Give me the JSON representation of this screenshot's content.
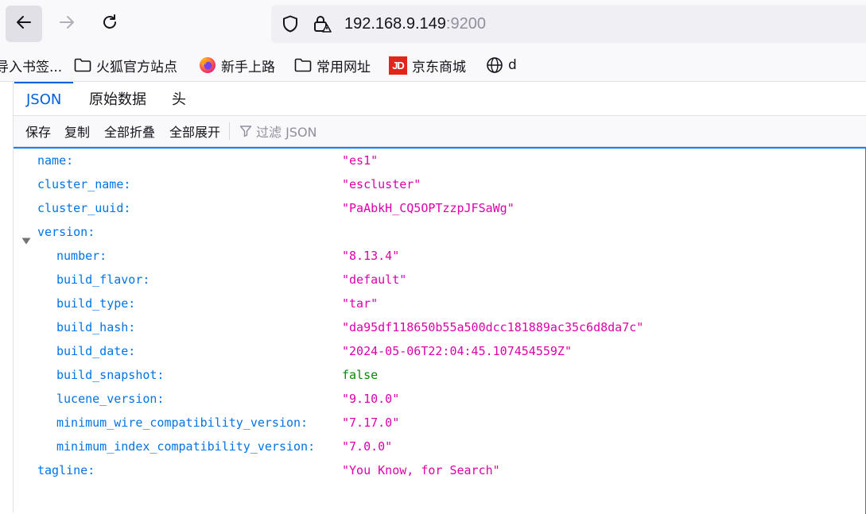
{
  "browser": {
    "url_host": "192.168.9.149",
    "url_port": ":9200"
  },
  "bookmarks": [
    {
      "label": "导入书签..."
    },
    {
      "label": "火狐官方站点"
    },
    {
      "label": "新手上路"
    },
    {
      "label": "常用网址"
    },
    {
      "label": "京东商城",
      "logo_text": "JD"
    },
    {
      "label": "d"
    }
  ],
  "viewer": {
    "tabs": [
      {
        "label": "JSON",
        "active": true
      },
      {
        "label": "原始数据"
      },
      {
        "label": "头"
      }
    ],
    "toolbar": {
      "save": "保存",
      "copy": "复制",
      "collapse_all": "全部折叠",
      "expand_all": "全部展开",
      "filter_placeholder": "过滤 JSON"
    }
  },
  "json_rows": [
    {
      "key": "name:",
      "value": "\"es1\""
    },
    {
      "key": "cluster_name:",
      "value": "\"escluster\""
    },
    {
      "key": "cluster_uuid:",
      "value": "\"PaAbkH_CQ5OPTzzpJFSaWg\""
    },
    {
      "key": "version:",
      "value": ""
    },
    {
      "key": "number:",
      "value": "\"8.13.4\""
    },
    {
      "key": "build_flavor:",
      "value": "\"default\""
    },
    {
      "key": "build_type:",
      "value": "\"tar\""
    },
    {
      "key": "build_hash:",
      "value": "\"da95df118650b55a500dcc181889ac35c6d8da7c\""
    },
    {
      "key": "build_date:",
      "value": "\"2024-05-06T22:04:45.107454559Z\""
    },
    {
      "key": "build_snapshot:",
      "value": "false"
    },
    {
      "key": "lucene_version:",
      "value": "\"9.10.0\""
    },
    {
      "key": "minimum_wire_compatibility_version:",
      "value": "\"7.17.0\""
    },
    {
      "key": "minimum_index_compatibility_version:",
      "value": "\"7.0.0\""
    },
    {
      "key": "tagline:",
      "value": "\"You Know, for Search\""
    }
  ],
  "colors": {
    "key": "#0074e8",
    "string": "#dd00a9",
    "boolean": "#058b00",
    "accent": "#0a84ff"
  }
}
